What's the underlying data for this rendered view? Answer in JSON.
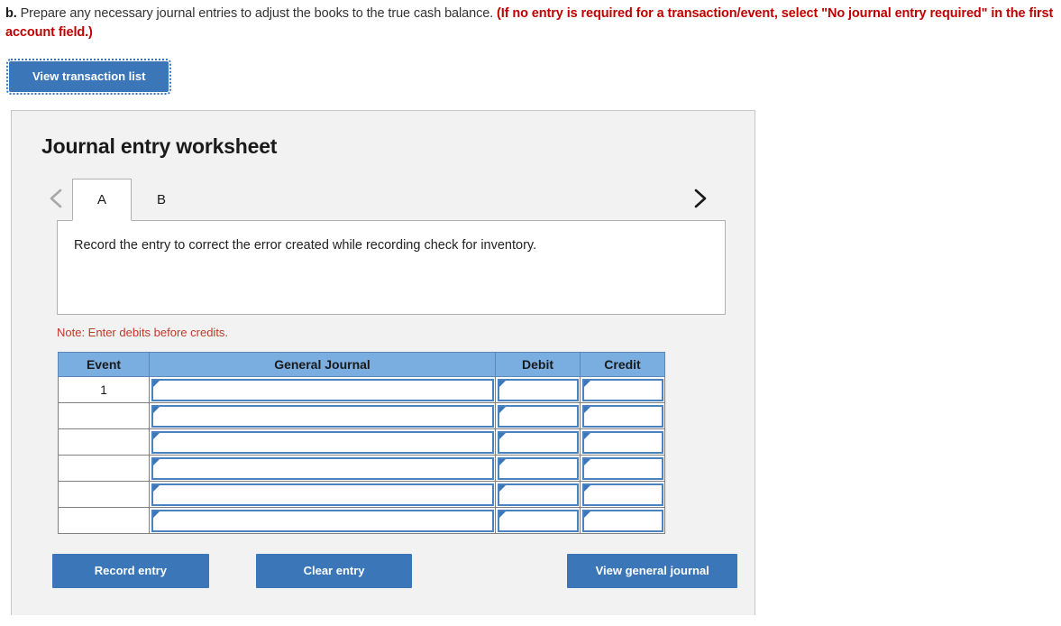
{
  "prompt": {
    "label": "b.",
    "text": " Prepare any necessary journal entries to adjust the books to the true cash balance. ",
    "red_text": "(If no entry is required for a transaction/event, select \"No journal entry required\" in the first account field.)"
  },
  "toolbar": {
    "view_transaction_list": "View transaction list"
  },
  "worksheet": {
    "title": "Journal entry worksheet",
    "prev_icon": "chevron-left-icon",
    "next_icon": "chevron-right-icon",
    "tabs": [
      {
        "label": "A",
        "active": true
      },
      {
        "label": "B",
        "active": false
      }
    ],
    "description": "Record the entry to correct the error created while recording check for inventory.",
    "note": "Note: Enter debits before credits.",
    "table": {
      "headers": [
        "Event",
        "General Journal",
        "Debit",
        "Credit"
      ],
      "rows": [
        {
          "event": "1",
          "general_journal": "",
          "debit": "",
          "credit": ""
        },
        {
          "event": "",
          "general_journal": "",
          "debit": "",
          "credit": ""
        },
        {
          "event": "",
          "general_journal": "",
          "debit": "",
          "credit": ""
        },
        {
          "event": "",
          "general_journal": "",
          "debit": "",
          "credit": ""
        },
        {
          "event": "",
          "general_journal": "",
          "debit": "",
          "credit": ""
        },
        {
          "event": "",
          "general_journal": "",
          "debit": "",
          "credit": ""
        }
      ]
    },
    "buttons": {
      "record_entry": "Record entry",
      "clear_entry": "Clear entry",
      "view_general_journal": "View general journal"
    }
  },
  "colors": {
    "accent_blue": "#3b76b8",
    "header_blue": "#7baee0",
    "input_border_blue": "#4a82bf",
    "alert_red": "#c00000",
    "note_red": "#c0392b",
    "panel_bg": "#f2f2f2"
  }
}
